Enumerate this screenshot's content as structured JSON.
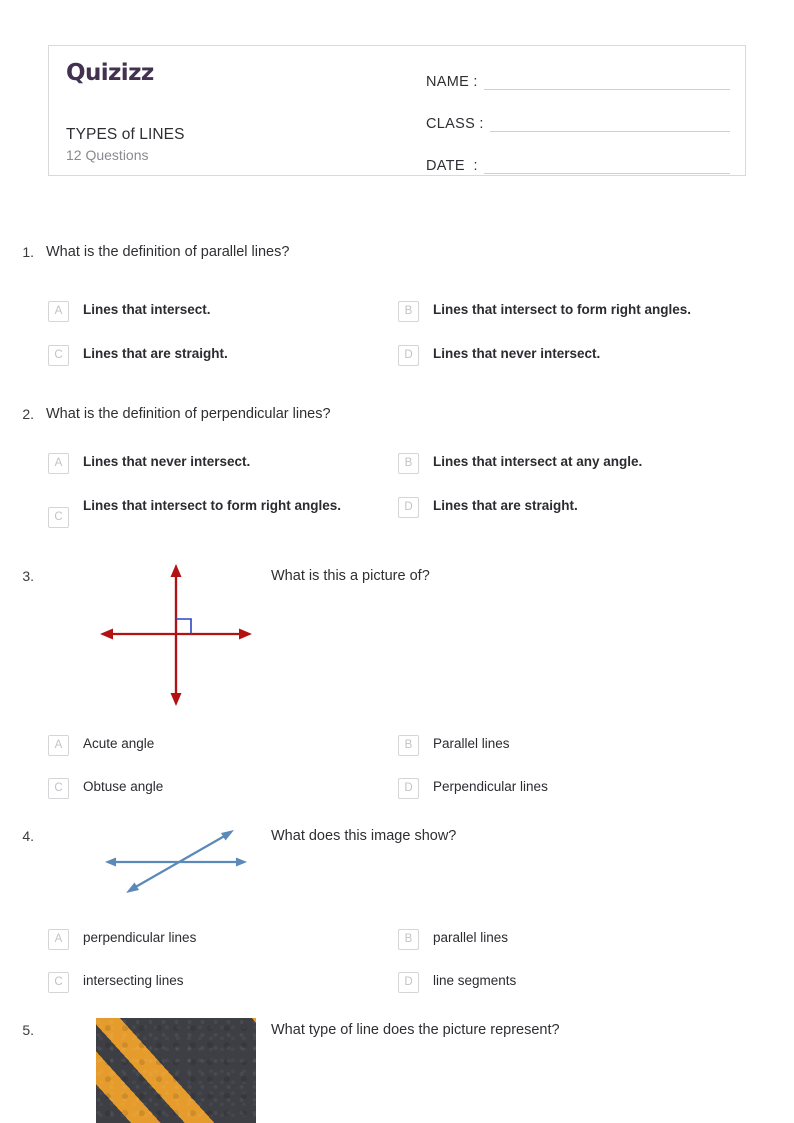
{
  "header": {
    "logo_text": "Quizizz",
    "quiz_title": "TYPES of LINES",
    "question_count": "12 Questions",
    "fields": [
      {
        "label": "NAME :"
      },
      {
        "label": "CLASS :"
      },
      {
        "label": "DATE  :"
      }
    ]
  },
  "colors": {
    "logo_purple": "#42324f",
    "diagram_red": "#b31212",
    "diagram_blue": "#2a46c0",
    "line_blue": "#5b89b8",
    "border_gray": "#d9d9d9",
    "badge_gray": "#c3c3c7",
    "road_asphalt": "#3d3f44",
    "road_stripe": "#e59c2c"
  },
  "questions": [
    {
      "number": "1.",
      "text": "What is the definition of parallel lines?",
      "bold_options": true,
      "options": [
        {
          "letter": "A",
          "label": "Lines that intersect."
        },
        {
          "letter": "B",
          "label": "Lines that intersect to form right angles."
        },
        {
          "letter": "C",
          "label": "Lines that are straight."
        },
        {
          "letter": "D",
          "label": "Lines that never intersect."
        }
      ]
    },
    {
      "number": "2.",
      "text": "What is the definition of perpendicular lines?",
      "bold_options": true,
      "options": [
        {
          "letter": "A",
          "label": "Lines that never intersect."
        },
        {
          "letter": "B",
          "label": "Lines that intersect at any angle."
        },
        {
          "letter": "C",
          "label": "Lines that intersect to form right angles."
        },
        {
          "letter": "D",
          "label": "Lines that are straight."
        }
      ]
    },
    {
      "number": "3.",
      "text": "What is this a picture of?",
      "bold_options": false,
      "figure": "perpendicular-lines-diagram",
      "options": [
        {
          "letter": "A",
          "label": "Acute angle"
        },
        {
          "letter": "B",
          "label": "Parallel lines"
        },
        {
          "letter": "C",
          "label": "Obtuse angle"
        },
        {
          "letter": "D",
          "label": "Perpendicular lines"
        }
      ]
    },
    {
      "number": "4.",
      "text": "What does this image show?",
      "bold_options": false,
      "figure": "intersecting-lines-diagram",
      "options": [
        {
          "letter": "A",
          "label": "perpendicular lines"
        },
        {
          "letter": "B",
          "label": "parallel lines"
        },
        {
          "letter": "C",
          "label": "intersecting lines"
        },
        {
          "letter": "D",
          "label": "line segments"
        }
      ]
    },
    {
      "number": "5.",
      "text": "What type of line does the picture represent?",
      "bold_options": false,
      "figure": "road-parallel-lines-photo",
      "options": []
    }
  ]
}
